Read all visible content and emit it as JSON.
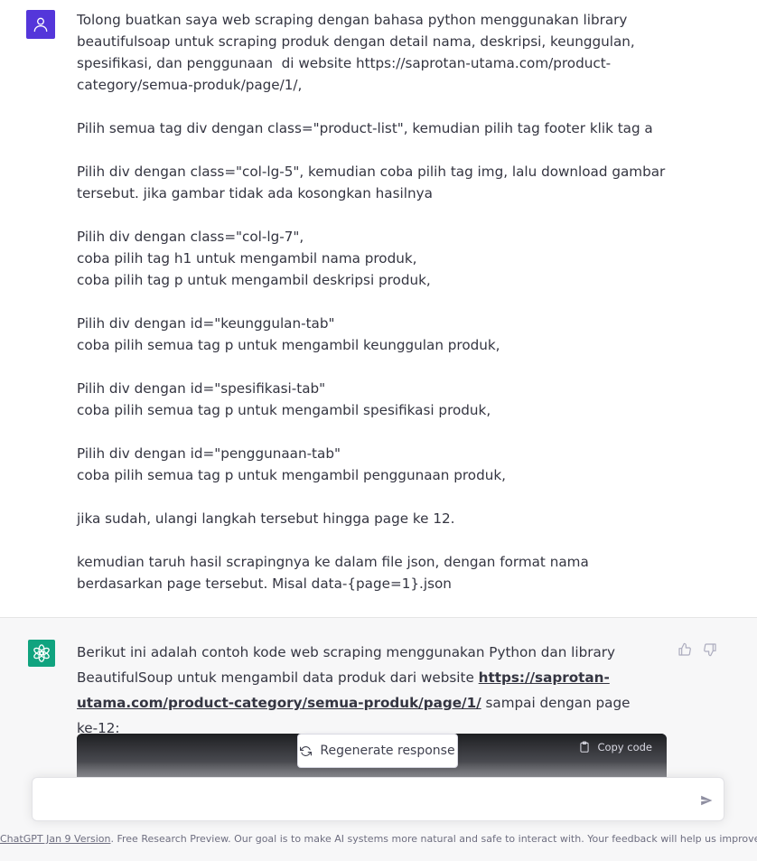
{
  "user_message": {
    "text": "Tolong buatkan saya web scraping dengan bahasa python menggunakan library beautifulsoap untuk scraping produk dengan detail nama, deskripsi, keunggulan, spesifikasi, dan penggunaan  di website https://saprotan-utama.com/product-category/semua-produk/page/1/,\n\nPilih semua tag div dengan class=\"product-list\", kemudian pilih tag footer klik tag a\n\nPilih div dengan class=\"col-lg-5\", kemudian coba pilih tag img, lalu download gambar tersebut. jika gambar tidak ada kosongkan hasilnya\n\nPilih div dengan class=\"col-lg-7\",\ncoba pilih tag h1 untuk mengambil nama produk,\ncoba pilih tag p untuk mengambil deskripsi produk,\n\nPilih div dengan id=\"keunggulan-tab\"\ncoba pilih semua tag p untuk mengambil keunggulan produk,\n\nPilih div dengan id=\"spesifikasi-tab\"\ncoba pilih semua tag p untuk mengambil spesifikasi produk,\n\nPilih div dengan id=\"penggunaan-tab\"\ncoba pilih semua tag p untuk mengambil penggunaan produk,\n\njika sudah, ulangi langkah tersebut hingga page ke 12.\n\nkemudian taruh hasil scrapingnya ke dalam file json, dengan format nama berdasarkan page tersebut. Misal data-{page=1}.json"
  },
  "assistant_message": {
    "text_before": "Berikut ini adalah contoh kode web scraping menggunakan Python dan library BeautifulSoup untuk mengambil data produk dari website ",
    "link_text": "https://saprotan-utama.com/product-category/semua-produk/page/1/",
    "text_after": " sampai dengan page ke-12:",
    "copy_code_label": "Copy code"
  },
  "regenerate_label": "Regenerate response",
  "composer": {
    "placeholder": "",
    "value": ""
  },
  "footer": {
    "version_link": "ChatGPT Jan 9 Version",
    "text": ". Free Research Preview. Our goal is to make AI systems more natural and safe to interact with. Your feedback will help us improve."
  },
  "colors": {
    "user_avatar": "#5436da",
    "assistant_avatar": "#10a37f",
    "assistant_bg": "#f7f7f8",
    "text": "#343541"
  },
  "icons": {
    "user_avatar": "user-icon",
    "assistant_avatar": "openai-logo-icon",
    "thumbs_up": "thumbs-up-icon",
    "thumbs_down": "thumbs-down-icon",
    "copy": "clipboard-icon",
    "regenerate": "refresh-icon",
    "send": "paper-plane-icon"
  }
}
